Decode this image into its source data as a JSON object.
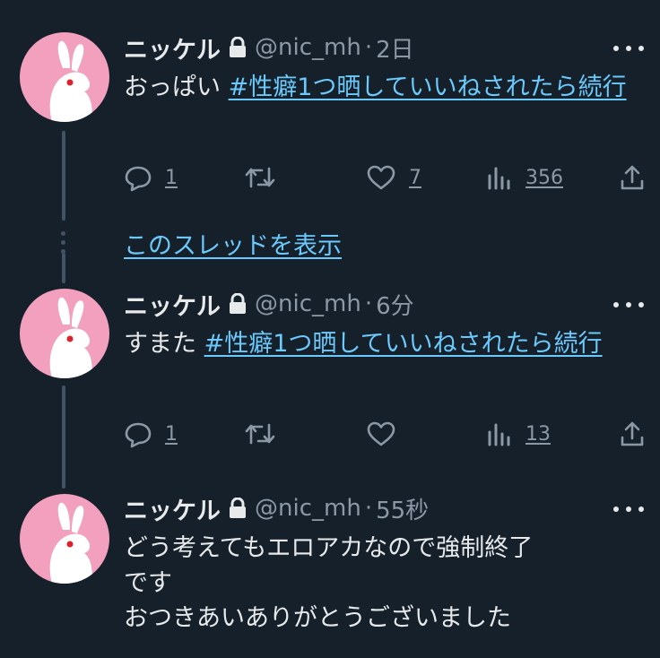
{
  "tweets": [
    {
      "name": "ニッケル",
      "handle": "@nic_mh",
      "separator": "·",
      "time": "2日",
      "text_prefix": "おっぱい ",
      "hashtag": "#性癖1つ晒していいねされたら続行",
      "reply_count": "1",
      "like_count": "7",
      "view_count": "356"
    },
    {
      "name": "ニッケル",
      "handle": "@nic_mh",
      "separator": "·",
      "time": "6分",
      "text_prefix": "すまた ",
      "hashtag": "#性癖1つ晒していいねされたら続行",
      "reply_count": "1",
      "like_count": "",
      "view_count": "13"
    },
    {
      "name": "ニッケル",
      "handle": "@nic_mh",
      "separator": "·",
      "time": "55秒",
      "line1": "どう考えてもエロアカなので強制終了",
      "line2": "です",
      "line3": "おつきあいありがとうございました"
    }
  ],
  "show_thread": "このスレッドを表示",
  "icons": {
    "reply": "reply-icon",
    "retweet": "retweet-icon",
    "like": "heart-icon",
    "views": "views-icon",
    "share": "share-icon",
    "lock": "lock-icon",
    "more": "more-icon"
  },
  "colors": {
    "background": "#15202b",
    "link": "#6bc9fb",
    "muted": "#8b98a5",
    "avatar": "#f2a0bd"
  }
}
